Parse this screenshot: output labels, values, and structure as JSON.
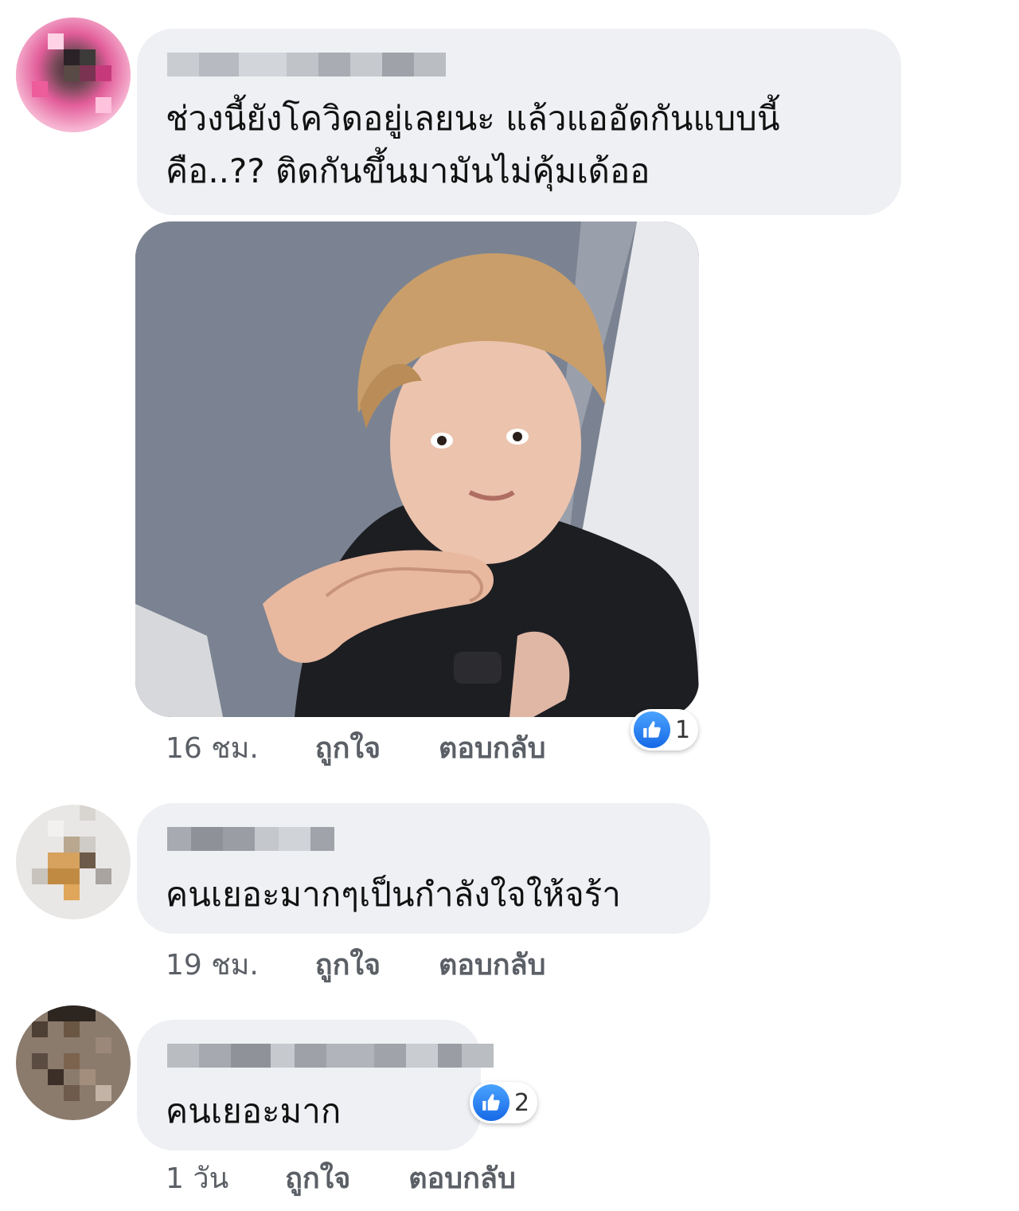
{
  "comments": [
    {
      "text_lines": [
        "ช่วงนี้ยังโควิดอยู่เลยนะ แล้วแออัดกันแบบนี้",
        "คือ..?? ติดกันขึ้นมามันไม่คุ้มเด้ออ"
      ],
      "time": "16 ชม.",
      "like_label": "ถูกใจ",
      "reply_label": "ตอบกลับ",
      "reaction_count": "1",
      "attachment": "photo of a man with blonde hair resting his chin on his hands, wide-eyed expression"
    },
    {
      "text_lines": [
        "คนเยอะมากๆเป็นกำลังใจให้จร้า"
      ],
      "time": "19 ชม.",
      "like_label": "ถูกใจ",
      "reply_label": "ตอบกลับ"
    },
    {
      "text_lines": [
        "คนเยอะมาก"
      ],
      "time": "1 วัน",
      "like_label": "ถูกใจ",
      "reply_label": "ตอบกลับ",
      "reaction_count": "2"
    }
  ],
  "colors": {
    "bubble": "#eef0f3",
    "like_blue": "#1877f2",
    "meta_text": "#5b5f66"
  },
  "icons": {
    "reaction": "like-thumbs-up-icon"
  }
}
